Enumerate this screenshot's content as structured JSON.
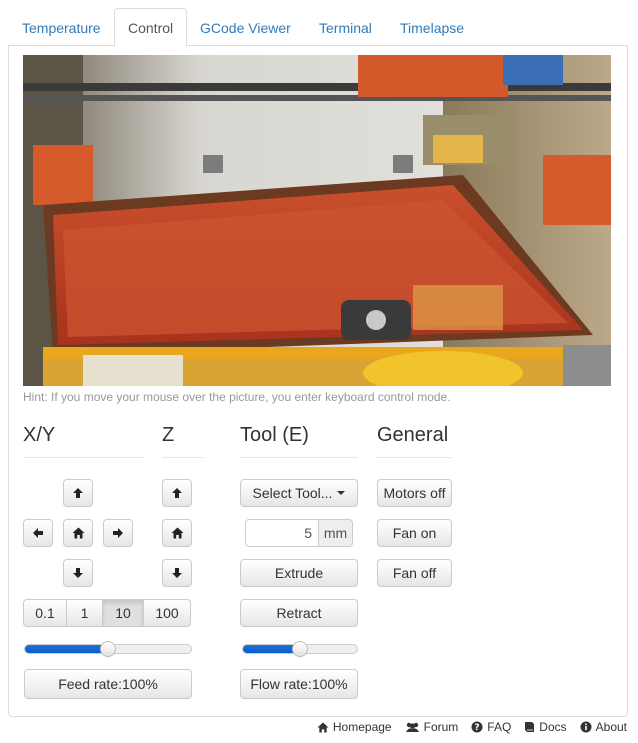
{
  "tabs": [
    {
      "label": "Temperature"
    },
    {
      "label": "Control"
    },
    {
      "label": "GCode Viewer"
    },
    {
      "label": "Terminal"
    },
    {
      "label": "Timelapse"
    }
  ],
  "active_tab": "Control",
  "hint": "Hint: If you move your mouse over the picture, you enter keyboard control mode.",
  "sections": {
    "xy": "X/Y",
    "z": "Z",
    "tool": "Tool (E)",
    "general": "General"
  },
  "icons": {
    "xy_up": "arrow-up-icon",
    "xy_left": "arrow-left-icon",
    "xy_home": "home-icon",
    "xy_right": "arrow-right-icon",
    "xy_down": "arrow-down-icon",
    "z_up": "arrow-up-icon",
    "z_home": "home-icon",
    "z_down": "arrow-down-icon"
  },
  "distances": [
    "0.1",
    "1",
    "10",
    "100"
  ],
  "selected_distance": "10",
  "feed_rate": {
    "label": "Feed rate:100%",
    "level_percent": 50
  },
  "tool": {
    "select_label": "Select Tool...",
    "extrude_amount": "5",
    "unit": "mm",
    "extrude_label": "Extrude",
    "retract_label": "Retract"
  },
  "flow_rate": {
    "label": "Flow rate:100%",
    "level_percent": 50
  },
  "general": {
    "motors_off": "Motors off",
    "fan_on": "Fan on",
    "fan_off": "Fan off"
  },
  "footer": [
    {
      "label": "Homepage",
      "icon": "home-icon"
    },
    {
      "label": "Forum",
      "icon": "users-icon"
    },
    {
      "label": "FAQ",
      "icon": "question-circle-icon"
    },
    {
      "label": "Docs",
      "icon": "book-icon"
    },
    {
      "label": "About",
      "icon": "info-circle-icon"
    }
  ]
}
